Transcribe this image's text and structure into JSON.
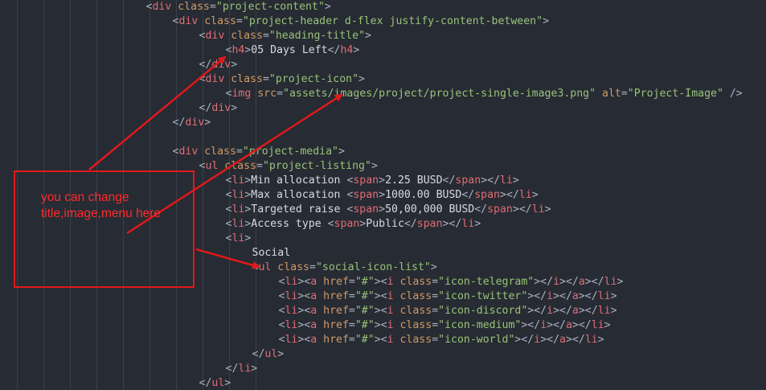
{
  "annotation": {
    "note_line1": "you can change",
    "note_line2": "title,image,menu here"
  },
  "code_lines": [
    {
      "indent": 11,
      "parts": [
        [
          "punc",
          "<"
        ],
        [
          "tag",
          "div"
        ],
        [
          "txt",
          " "
        ],
        [
          "attr",
          "class"
        ],
        [
          "punc",
          "="
        ],
        [
          "str",
          "\"project-content\""
        ],
        [
          "punc",
          ">"
        ]
      ]
    },
    {
      "indent": 13,
      "parts": [
        [
          "punc",
          "<"
        ],
        [
          "tag",
          "div"
        ],
        [
          "txt",
          " "
        ],
        [
          "attr",
          "class"
        ],
        [
          "punc",
          "="
        ],
        [
          "str",
          "\"project-header d-flex justify-content-between\""
        ],
        [
          "punc",
          ">"
        ]
      ]
    },
    {
      "indent": 15,
      "parts": [
        [
          "punc",
          "<"
        ],
        [
          "tag",
          "div"
        ],
        [
          "txt",
          " "
        ],
        [
          "attr",
          "class"
        ],
        [
          "punc",
          "="
        ],
        [
          "str",
          "\"heading-title\""
        ],
        [
          "punc",
          ">"
        ]
      ]
    },
    {
      "indent": 17,
      "parts": [
        [
          "punc",
          "<"
        ],
        [
          "tag",
          "h4"
        ],
        [
          "punc",
          ">"
        ],
        [
          "txt",
          "05 Days Left"
        ],
        [
          "punc",
          "</"
        ],
        [
          "tag",
          "h4"
        ],
        [
          "punc",
          ">"
        ]
      ]
    },
    {
      "indent": 15,
      "parts": [
        [
          "punc",
          "</"
        ],
        [
          "tag",
          "div"
        ],
        [
          "punc",
          ">"
        ]
      ]
    },
    {
      "indent": 15,
      "parts": [
        [
          "punc",
          "<"
        ],
        [
          "tag",
          "div"
        ],
        [
          "txt",
          " "
        ],
        [
          "attr",
          "class"
        ],
        [
          "punc",
          "="
        ],
        [
          "str",
          "\"project-icon\""
        ],
        [
          "punc",
          ">"
        ]
      ]
    },
    {
      "indent": 17,
      "parts": [
        [
          "punc",
          "<"
        ],
        [
          "tag",
          "img"
        ],
        [
          "txt",
          " "
        ],
        [
          "attr",
          "src"
        ],
        [
          "punc",
          "="
        ],
        [
          "str",
          "\"assets/images/project/project-single-image3.png\""
        ],
        [
          "txt",
          " "
        ],
        [
          "attr",
          "alt"
        ],
        [
          "punc",
          "="
        ],
        [
          "str",
          "\"Project-Image\""
        ],
        [
          "txt",
          " "
        ],
        [
          "punc",
          "/>"
        ]
      ]
    },
    {
      "indent": 15,
      "parts": [
        [
          "punc",
          "</"
        ],
        [
          "tag",
          "div"
        ],
        [
          "punc",
          ">"
        ]
      ]
    },
    {
      "indent": 13,
      "parts": [
        [
          "punc",
          "</"
        ],
        [
          "tag",
          "div"
        ],
        [
          "punc",
          ">"
        ]
      ]
    },
    {
      "indent": 0,
      "parts": []
    },
    {
      "indent": 13,
      "parts": [
        [
          "punc",
          "<"
        ],
        [
          "tag",
          "div"
        ],
        [
          "txt",
          " "
        ],
        [
          "attr",
          "class"
        ],
        [
          "punc",
          "="
        ],
        [
          "str",
          "\"project-media\""
        ],
        [
          "punc",
          ">"
        ]
      ]
    },
    {
      "indent": 15,
      "parts": [
        [
          "punc",
          "<"
        ],
        [
          "tag",
          "ul"
        ],
        [
          "txt",
          " "
        ],
        [
          "attr",
          "class"
        ],
        [
          "punc",
          "="
        ],
        [
          "str",
          "\"project-listing\""
        ],
        [
          "punc",
          ">"
        ]
      ]
    },
    {
      "indent": 17,
      "parts": [
        [
          "punc",
          "<"
        ],
        [
          "tag",
          "li"
        ],
        [
          "punc",
          ">"
        ],
        [
          "txt",
          "Min allocation "
        ],
        [
          "punc",
          "<"
        ],
        [
          "tag",
          "span"
        ],
        [
          "punc",
          ">"
        ],
        [
          "txt",
          "2.25 BUSD"
        ],
        [
          "punc",
          "</"
        ],
        [
          "tag",
          "span"
        ],
        [
          "punc",
          "></"
        ],
        [
          "tag",
          "li"
        ],
        [
          "punc",
          ">"
        ]
      ]
    },
    {
      "indent": 17,
      "parts": [
        [
          "punc",
          "<"
        ],
        [
          "tag",
          "li"
        ],
        [
          "punc",
          ">"
        ],
        [
          "txt",
          "Max allocation "
        ],
        [
          "punc",
          "<"
        ],
        [
          "tag",
          "span"
        ],
        [
          "punc",
          ">"
        ],
        [
          "txt",
          "1000.00 BUSD"
        ],
        [
          "punc",
          "</"
        ],
        [
          "tag",
          "span"
        ],
        [
          "punc",
          "></"
        ],
        [
          "tag",
          "li"
        ],
        [
          "punc",
          ">"
        ]
      ]
    },
    {
      "indent": 17,
      "parts": [
        [
          "punc",
          "<"
        ],
        [
          "tag",
          "li"
        ],
        [
          "punc",
          ">"
        ],
        [
          "txt",
          "Targeted raise "
        ],
        [
          "punc",
          "<"
        ],
        [
          "tag",
          "span"
        ],
        [
          "punc",
          ">"
        ],
        [
          "txt",
          "50,00,000 BUSD"
        ],
        [
          "punc",
          "</"
        ],
        [
          "tag",
          "span"
        ],
        [
          "punc",
          "></"
        ],
        [
          "tag",
          "li"
        ],
        [
          "punc",
          ">"
        ]
      ]
    },
    {
      "indent": 17,
      "parts": [
        [
          "punc",
          "<"
        ],
        [
          "tag",
          "li"
        ],
        [
          "punc",
          ">"
        ],
        [
          "txt",
          "Access type "
        ],
        [
          "punc",
          "<"
        ],
        [
          "tag",
          "span"
        ],
        [
          "punc",
          ">"
        ],
        [
          "txt",
          "Public"
        ],
        [
          "punc",
          "</"
        ],
        [
          "tag",
          "span"
        ],
        [
          "punc",
          "></"
        ],
        [
          "tag",
          "li"
        ],
        [
          "punc",
          ">"
        ]
      ]
    },
    {
      "indent": 17,
      "parts": [
        [
          "punc",
          "<"
        ],
        [
          "tag",
          "li"
        ],
        [
          "punc",
          ">"
        ]
      ]
    },
    {
      "indent": 19,
      "parts": [
        [
          "txt",
          "Social"
        ]
      ]
    },
    {
      "indent": 19,
      "parts": [
        [
          "punc",
          "<"
        ],
        [
          "tag",
          "ul"
        ],
        [
          "txt",
          " "
        ],
        [
          "attr",
          "class"
        ],
        [
          "punc",
          "="
        ],
        [
          "str",
          "\"social-icon-list\""
        ],
        [
          "punc",
          ">"
        ]
      ]
    },
    {
      "indent": 21,
      "parts": [
        [
          "punc",
          "<"
        ],
        [
          "tag",
          "li"
        ],
        [
          "punc",
          "><"
        ],
        [
          "tag",
          "a"
        ],
        [
          "txt",
          " "
        ],
        [
          "attr",
          "href"
        ],
        [
          "punc",
          "="
        ],
        [
          "str",
          "\"#\""
        ],
        [
          "punc",
          "><"
        ],
        [
          "tag",
          "i"
        ],
        [
          "txt",
          " "
        ],
        [
          "attr",
          "class"
        ],
        [
          "punc",
          "="
        ],
        [
          "str",
          "\"icon-telegram\""
        ],
        [
          "punc",
          "></"
        ],
        [
          "tag",
          "i"
        ],
        [
          "punc",
          "></"
        ],
        [
          "tag",
          "a"
        ],
        [
          "punc",
          "></"
        ],
        [
          "tag",
          "li"
        ],
        [
          "punc",
          ">"
        ]
      ]
    },
    {
      "indent": 21,
      "parts": [
        [
          "punc",
          "<"
        ],
        [
          "tag",
          "li"
        ],
        [
          "punc",
          "><"
        ],
        [
          "tag",
          "a"
        ],
        [
          "txt",
          " "
        ],
        [
          "attr",
          "href"
        ],
        [
          "punc",
          "="
        ],
        [
          "str",
          "\"#\""
        ],
        [
          "punc",
          "><"
        ],
        [
          "tag",
          "i"
        ],
        [
          "txt",
          " "
        ],
        [
          "attr",
          "class"
        ],
        [
          "punc",
          "="
        ],
        [
          "str",
          "\"icon-twitter\""
        ],
        [
          "punc",
          "></"
        ],
        [
          "tag",
          "i"
        ],
        [
          "punc",
          "></"
        ],
        [
          "tag",
          "a"
        ],
        [
          "punc",
          "></"
        ],
        [
          "tag",
          "li"
        ],
        [
          "punc",
          ">"
        ]
      ]
    },
    {
      "indent": 21,
      "parts": [
        [
          "punc",
          "<"
        ],
        [
          "tag",
          "li"
        ],
        [
          "punc",
          "><"
        ],
        [
          "tag",
          "a"
        ],
        [
          "txt",
          " "
        ],
        [
          "attr",
          "href"
        ],
        [
          "punc",
          "="
        ],
        [
          "str",
          "\"#\""
        ],
        [
          "punc",
          "><"
        ],
        [
          "tag",
          "i"
        ],
        [
          "txt",
          " "
        ],
        [
          "attr",
          "class"
        ],
        [
          "punc",
          "="
        ],
        [
          "str",
          "\"icon-discord\""
        ],
        [
          "punc",
          "></"
        ],
        [
          "tag",
          "i"
        ],
        [
          "punc",
          "></"
        ],
        [
          "tag",
          "a"
        ],
        [
          "punc",
          "></"
        ],
        [
          "tag",
          "li"
        ],
        [
          "punc",
          ">"
        ]
      ]
    },
    {
      "indent": 21,
      "parts": [
        [
          "punc",
          "<"
        ],
        [
          "tag",
          "li"
        ],
        [
          "punc",
          "><"
        ],
        [
          "tag",
          "a"
        ],
        [
          "txt",
          " "
        ],
        [
          "attr",
          "href"
        ],
        [
          "punc",
          "="
        ],
        [
          "str",
          "\"#\""
        ],
        [
          "punc",
          "><"
        ],
        [
          "tag",
          "i"
        ],
        [
          "txt",
          " "
        ],
        [
          "attr",
          "class"
        ],
        [
          "punc",
          "="
        ],
        [
          "str",
          "\"icon-medium\""
        ],
        [
          "punc",
          "></"
        ],
        [
          "tag",
          "i"
        ],
        [
          "punc",
          "></"
        ],
        [
          "tag",
          "a"
        ],
        [
          "punc",
          "></"
        ],
        [
          "tag",
          "li"
        ],
        [
          "punc",
          ">"
        ]
      ]
    },
    {
      "indent": 21,
      "parts": [
        [
          "punc",
          "<"
        ],
        [
          "tag",
          "li"
        ],
        [
          "punc",
          "><"
        ],
        [
          "tag",
          "a"
        ],
        [
          "txt",
          " "
        ],
        [
          "attr",
          "href"
        ],
        [
          "punc",
          "="
        ],
        [
          "str",
          "\"#\""
        ],
        [
          "punc",
          "><"
        ],
        [
          "tag",
          "i"
        ],
        [
          "txt",
          " "
        ],
        [
          "attr",
          "class"
        ],
        [
          "punc",
          "="
        ],
        [
          "str",
          "\"icon-world\""
        ],
        [
          "punc",
          "></"
        ],
        [
          "tag",
          "i"
        ],
        [
          "punc",
          "></"
        ],
        [
          "tag",
          "a"
        ],
        [
          "punc",
          "></"
        ],
        [
          "tag",
          "li"
        ],
        [
          "punc",
          ">"
        ]
      ]
    },
    {
      "indent": 19,
      "parts": [
        [
          "punc",
          "</"
        ],
        [
          "tag",
          "ul"
        ],
        [
          "punc",
          ">"
        ]
      ]
    },
    {
      "indent": 17,
      "parts": [
        [
          "punc",
          "</"
        ],
        [
          "tag",
          "li"
        ],
        [
          "punc",
          ">"
        ]
      ]
    },
    {
      "indent": 15,
      "parts": [
        [
          "punc",
          "</"
        ],
        [
          "tag",
          "ul"
        ],
        [
          "punc",
          ">"
        ]
      ]
    }
  ]
}
